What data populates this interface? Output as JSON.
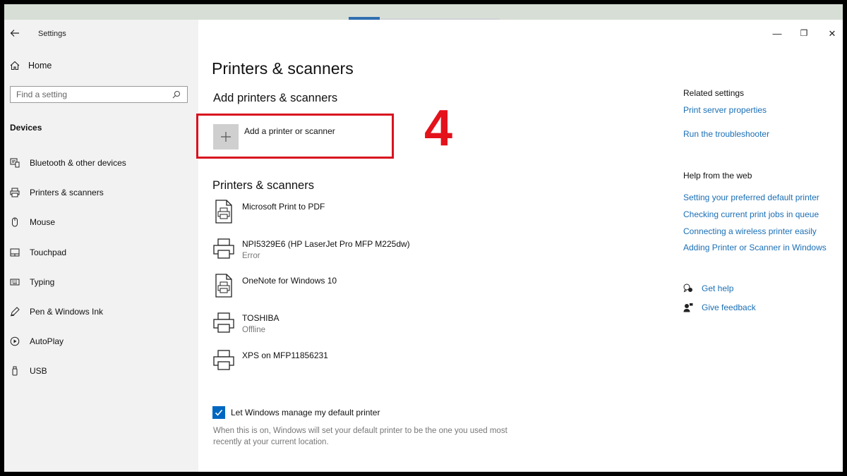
{
  "window": {
    "title": "Settings",
    "controls": {
      "minimize": "—",
      "maximize": "❐",
      "close": "✕"
    }
  },
  "sidebar": {
    "home_label": "Home",
    "search_placeholder": "Find a setting",
    "section_label": "Devices",
    "items": [
      {
        "label": "Bluetooth & other devices",
        "icon": "bluetooth-devices-icon"
      },
      {
        "label": "Printers & scanners",
        "icon": "printer-icon"
      },
      {
        "label": "Mouse",
        "icon": "mouse-icon"
      },
      {
        "label": "Touchpad",
        "icon": "touchpad-icon"
      },
      {
        "label": "Typing",
        "icon": "keyboard-icon"
      },
      {
        "label": "Pen & Windows Ink",
        "icon": "pen-icon"
      },
      {
        "label": "AutoPlay",
        "icon": "autoplay-icon"
      },
      {
        "label": "USB",
        "icon": "usb-icon"
      }
    ]
  },
  "main": {
    "page_title": "Printers & scanners",
    "add_section_title": "Add printers & scanners",
    "add_button_label": "Add a printer or scanner",
    "annotation_number": "4",
    "list_section_title": "Printers & scanners",
    "printers": [
      {
        "name": "Microsoft Print to PDF",
        "status": "",
        "icon": "document-printer-icon"
      },
      {
        "name": "NPI5329E6 (HP LaserJet Pro MFP M225dw)",
        "status": "Error",
        "icon": "printer-icon"
      },
      {
        "name": "OneNote for Windows 10",
        "status": "",
        "icon": "document-printer-icon"
      },
      {
        "name": "TOSHIBA",
        "status": "Offline",
        "icon": "printer-icon"
      },
      {
        "name": "XPS on MFP11856231",
        "status": "",
        "icon": "printer-icon"
      }
    ],
    "default_printer_label": "Let Windows manage my default printer",
    "default_printer_checked": true,
    "default_printer_description": "When this is on, Windows will set your default printer to be the one you used most recently at your current location."
  },
  "related": {
    "heading": "Related settings",
    "links": [
      "Print server properties",
      "Run the troubleshooter"
    ],
    "web_heading": "Help from the web",
    "web_links": [
      "Setting your preferred default printer",
      "Checking current print jobs in queue",
      "Connecting a wireless printer easily",
      "Adding Printer or Scanner in Windows"
    ],
    "get_help": "Get help",
    "give_feedback": "Give feedback"
  },
  "colors": {
    "accent": "#0067c0",
    "link": "#1a6fb5",
    "annotation_red": "#d8121f",
    "sidebar_bg": "#f2f2f2"
  }
}
